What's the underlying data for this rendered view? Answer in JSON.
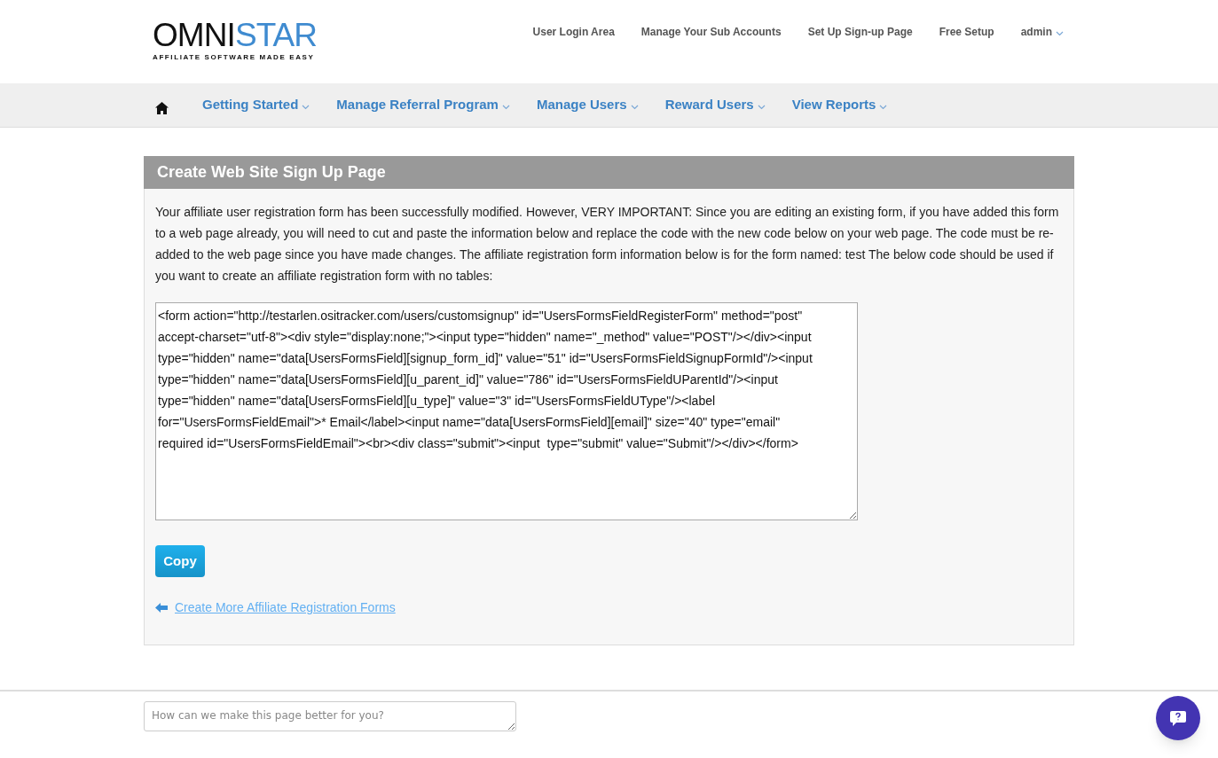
{
  "logo": {
    "word_dark": "OMNI",
    "word_accent": "STAR",
    "tagline": "AFFILIATE SOFTWARE MADE EASY"
  },
  "top_links": [
    {
      "label": "User Login Area",
      "dropdown": false
    },
    {
      "label": "Manage Your Sub Accounts",
      "dropdown": false
    },
    {
      "label": "Set Up Sign-up Page",
      "dropdown": false
    },
    {
      "label": "Free Setup",
      "dropdown": false
    },
    {
      "label": "admin",
      "dropdown": true
    }
  ],
  "nav": [
    {
      "label": "Getting Started"
    },
    {
      "label": "Manage Referral Program"
    },
    {
      "label": "Manage Users"
    },
    {
      "label": "Reward Users"
    },
    {
      "label": "View Reports"
    }
  ],
  "panel": {
    "title": "Create Web Site Sign Up Page",
    "message": "Your affiliate user registration form has been successfully modified. However, VERY IMPORTANT: Since you are editing an existing form, if you have added this form to a web page already, you will need to cut and paste the information below and replace the code with the new code below on your web page. The code must be re-added to the web page since you have made changes. The affiliate registration form information below is for the form named: test The below code should be used if you want to create an affiliate registration form with no tables:",
    "code": "<form action=\"http://testarlen.ositracker.com/users/customsignup\" id=\"UsersFormsFieldRegisterForm\" method=\"post\" accept-charset=\"utf-8\"><div style=\"display:none;\"><input type=\"hidden\" name=\"_method\" value=\"POST\"/></div><input type=\"hidden\" name=\"data[UsersFormsField][signup_form_id]\" value=\"51\" id=\"UsersFormsFieldSignupFormId\"/><input type=\"hidden\" name=\"data[UsersFormsField][u_parent_id]\" value=\"786\" id=\"UsersFormsFieldUParentId\"/><input type=\"hidden\" name=\"data[UsersFormsField][u_type]\" value=\"3\" id=\"UsersFormsFieldUType\"/><label for=\"UsersFormsFieldEmail\">* Email</label><input name=\"data[UsersFormsField][email]\" size=\"40\" type=\"email\" required id=\"UsersFormsFieldEmail\"><br><div class=\"submit\"><input  type=\"submit\" value=\"Submit\"/></div></form>",
    "copy_button": "Copy",
    "back_link": "Create More Affiliate Registration Forms"
  },
  "feedback": {
    "placeholder": "How can we make this page better for you?"
  }
}
